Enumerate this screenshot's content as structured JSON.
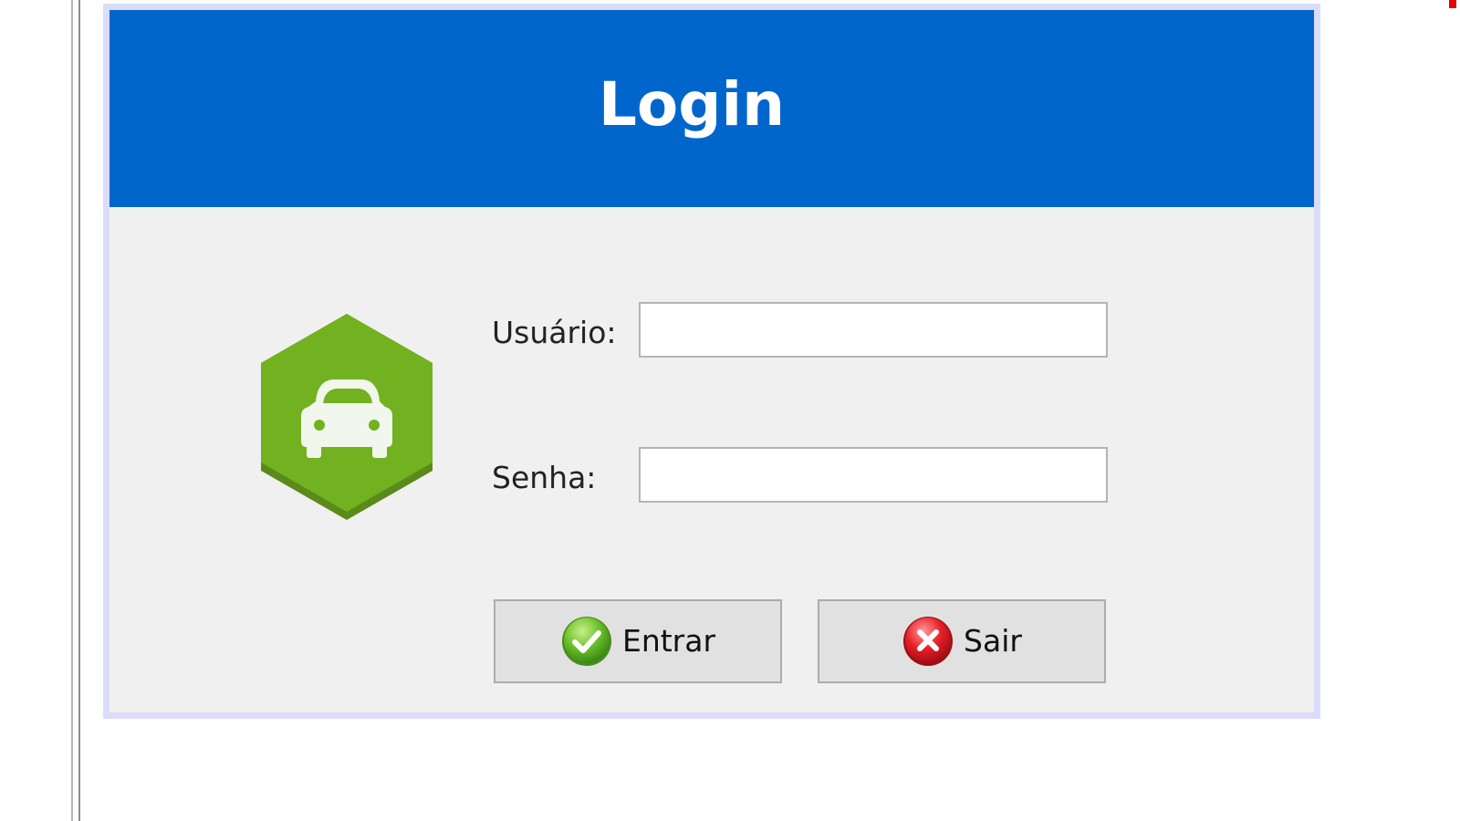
{
  "window": {
    "title": "Login"
  },
  "logo": {
    "icon": "car-icon",
    "color": "#72b11f"
  },
  "form": {
    "user_label": "Usuário:",
    "user_value": "",
    "password_label": "Senha:",
    "password_value": ""
  },
  "buttons": {
    "enter_label": "Entrar",
    "enter_icon": "check-icon",
    "exit_label": "Sair",
    "exit_icon": "close-icon"
  },
  "colors": {
    "header": "#0066cc",
    "panel": "#f0f0f0",
    "frame_border": "#dcdcfa",
    "button": "#e1e1e1"
  }
}
